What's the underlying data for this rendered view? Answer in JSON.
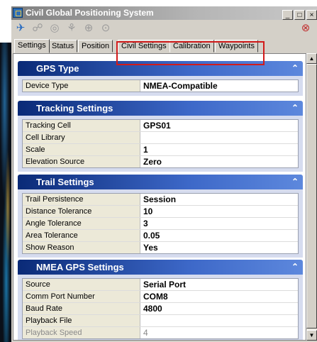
{
  "window": {
    "title": "Civil Global Positioning System"
  },
  "title_buttons": {
    "minimize": "_",
    "maximize": "□",
    "close": "×"
  },
  "toolbar": {
    "icons": [
      "gps-connect-icon",
      "gps-point-icon",
      "gps-target-icon",
      "gps-track-icon",
      "gps-crosshair-icon",
      "gps-circle-icon",
      "disconnect-icon"
    ]
  },
  "tabs": [
    "Settings",
    "Status",
    "Position",
    "Civil Settings",
    "Calibration",
    "Waypoints"
  ],
  "sections": {
    "gps_type": {
      "title": "GPS Type",
      "rows": [
        {
          "label": "Device Type",
          "value": "NMEA-Compatible"
        }
      ]
    },
    "tracking": {
      "title": "Tracking Settings",
      "rows": [
        {
          "label": "Tracking Cell",
          "value": "GPS01"
        },
        {
          "label": "Cell Library",
          "value": ""
        },
        {
          "label": "Scale",
          "value": "1"
        },
        {
          "label": "Elevation Source",
          "value": "Zero"
        }
      ]
    },
    "trail": {
      "title": "Trail Settings",
      "rows": [
        {
          "label": "Trail Persistence",
          "value": "Session"
        },
        {
          "label": "Distance Tolerance",
          "value": "10"
        },
        {
          "label": "Angle Tolerance",
          "value": "3"
        },
        {
          "label": "Area Tolerance",
          "value": "0.05"
        },
        {
          "label": "Show Reason",
          "value": "Yes"
        }
      ]
    },
    "nmea": {
      "title": "NMEA GPS Settings",
      "rows": [
        {
          "label": "Source",
          "value": "Serial Port"
        },
        {
          "label": "Comm Port Number",
          "value": "COM8"
        },
        {
          "label": "Baud Rate",
          "value": "4800"
        },
        {
          "label": "Playback File",
          "value": ""
        },
        {
          "label": "Playback Speed",
          "value": "4"
        }
      ]
    }
  },
  "colors": {
    "section_header": "#0a2a77",
    "highlight_box": "#d21b1b",
    "section_body": "#d6dcef"
  }
}
